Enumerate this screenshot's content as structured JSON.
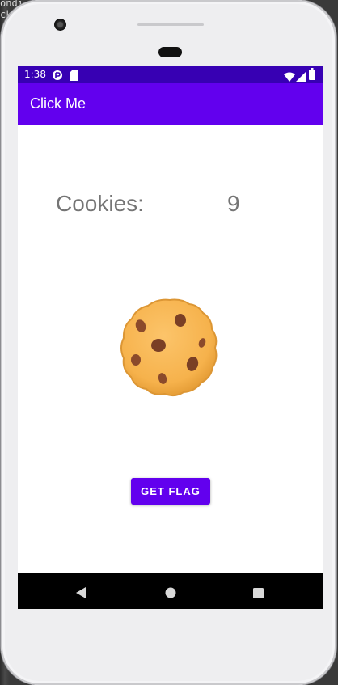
{
  "background": {
    "lines": [
      "ondi",
      "ck",
      "",
      "",
      "",
      "",
      ""
    ]
  },
  "status_bar": {
    "time": "1:38",
    "color": "#3700b3",
    "icons": [
      "wifi-icon",
      "signal-icon",
      "battery-icon",
      "play-protect-icon",
      "sd-card-icon"
    ]
  },
  "app_bar": {
    "title": "Click Me",
    "color": "#6200ee"
  },
  "main": {
    "cookies_label": "Cookies:",
    "cookies_count": "9",
    "cookie_icon": "cookie-icon",
    "button_label": "GET FLAG",
    "accent_color": "#6200ee"
  },
  "nav_bar": {
    "buttons": [
      "back-icon",
      "home-icon",
      "recents-icon"
    ]
  }
}
